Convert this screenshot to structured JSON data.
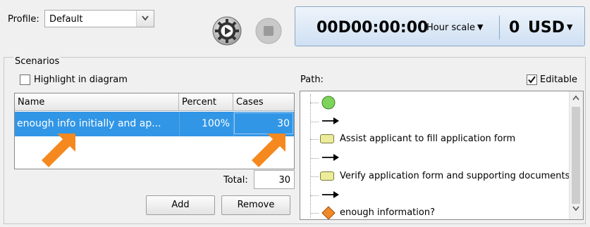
{
  "profile": {
    "label": "Profile:",
    "value": "Default"
  },
  "simulation": {
    "time": "00D00:00:00",
    "scale": "Hour scale",
    "cost": "0",
    "currency": "USD"
  },
  "scenarios": {
    "title": "Scenarios",
    "highlight_label": "Highlight in diagram",
    "highlight_checked": false,
    "columns": [
      "Name",
      "Percent",
      "Cases"
    ],
    "rows": [
      {
        "name": "enough info initially and ap...",
        "percent": "100%",
        "cases": "30"
      }
    ],
    "total_label": "Total:",
    "total_value": "30",
    "add_label": "Add",
    "remove_label": "Remove"
  },
  "path": {
    "label": "Path:",
    "editable_label": "Editable",
    "editable_checked": true,
    "items": [
      {
        "kind": "start-event"
      },
      {
        "kind": "flow"
      },
      {
        "kind": "task",
        "text": "Assist applicant to fill application form"
      },
      {
        "kind": "flow"
      },
      {
        "kind": "task",
        "text": "Verify application form and supporting documents"
      },
      {
        "kind": "flow"
      },
      {
        "kind": "gateway",
        "text": "enough information?"
      }
    ]
  },
  "colors": {
    "selection": "#3296e6",
    "arrow_annotation": "#f5891f",
    "start_event": "#7ed35a",
    "task_fill": "#ecec9a",
    "gateway": "#f08a28"
  },
  "icons": {
    "play": "run-simulation-icon",
    "stop": "stop-simulation-icon"
  }
}
